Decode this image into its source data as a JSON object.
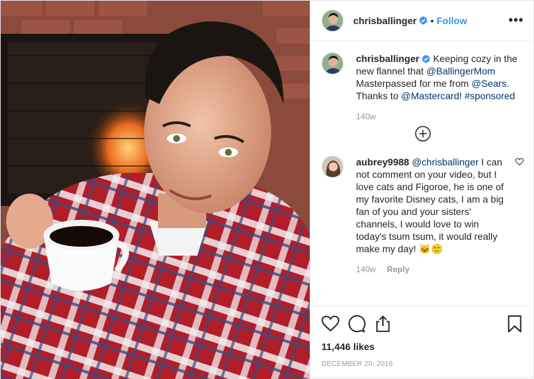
{
  "post": {
    "username": "chrisballinger",
    "follow_label": "Follow",
    "more_label": "•••",
    "caption": {
      "username": "chrisballinger",
      "parts": [
        {
          "t": " Keeping cozy in the new flannel that "
        },
        {
          "t": "@BallingerMom",
          "link": true
        },
        {
          "t": " Masterpassed for me from "
        },
        {
          "t": "@Sears",
          "link": true
        },
        {
          "t": ". Thanks to "
        },
        {
          "t": "@Mastercard",
          "link": true
        },
        {
          "t": "! "
        },
        {
          "t": "#sponsored",
          "link": true
        }
      ],
      "time": "140w"
    },
    "comment": {
      "username": "aubrey9988",
      "mention": "@chrisballinger",
      "text": " I can not comment on your video, but I love cats and Figoroe, he is one of my favorite Disney cats, I am a big fan of you and your sisters' channels, I would love to win today's tsum tsum, it would really make my day! 🐱🙂",
      "time": "140w",
      "reply_label": "Reply"
    },
    "likes": "11,446 likes",
    "date": "DECEMBER 20, 2016"
  },
  "colors": {
    "accent": "#3897f0",
    "link": "#003569",
    "muted": "#999999"
  },
  "icons": [
    "verified-badge-icon",
    "more-options-icon",
    "load-more-comments-icon",
    "like-comment-icon",
    "heart-icon",
    "comment-icon",
    "share-icon",
    "bookmark-icon"
  ]
}
